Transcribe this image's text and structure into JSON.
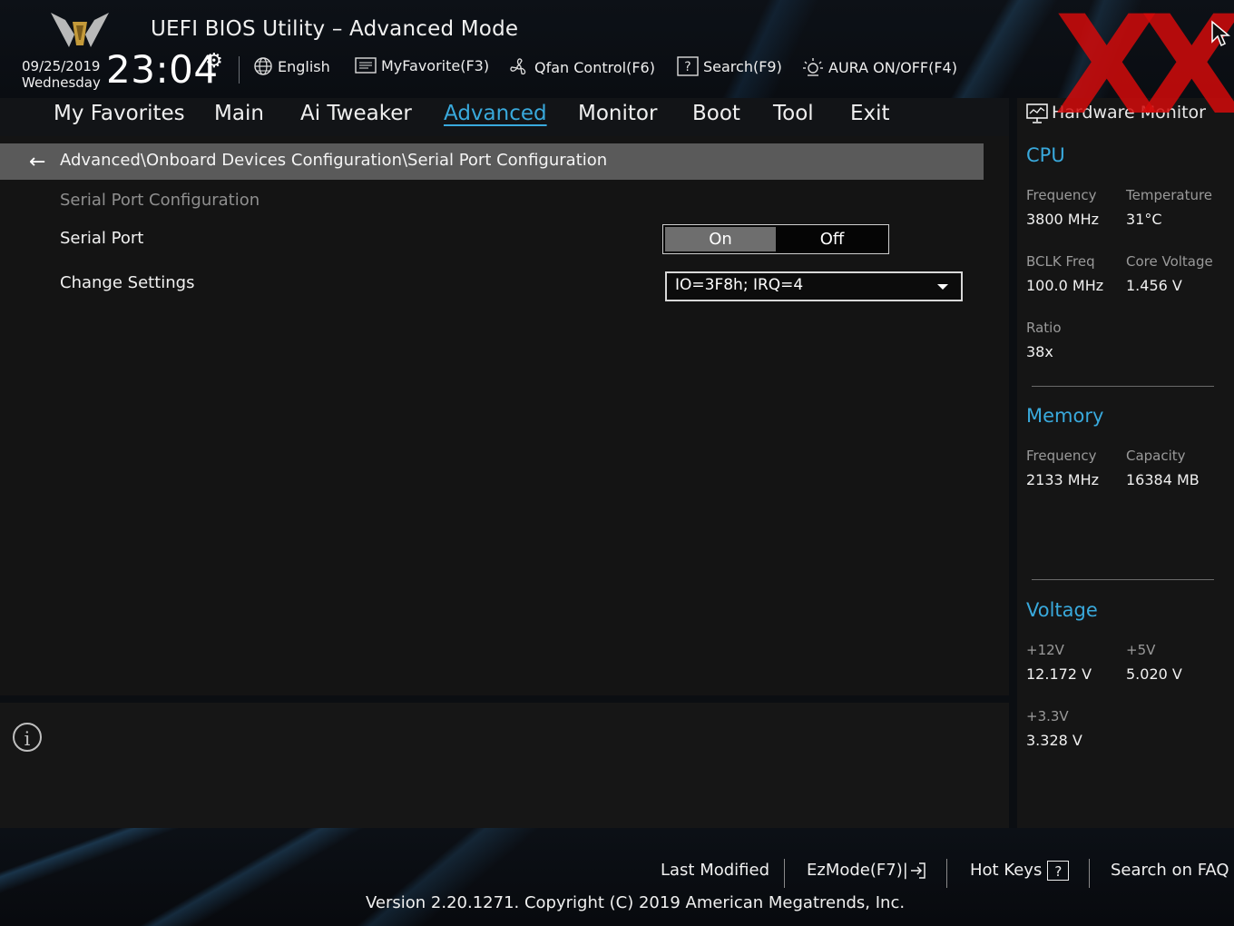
{
  "header": {
    "title": "UEFI BIOS Utility – Advanced Mode",
    "date": "09/25/2019",
    "weekday": "Wednesday",
    "time": "23:04",
    "tools": [
      {
        "label": "English",
        "icon": "globe-icon"
      },
      {
        "label": "MyFavorite(F3)",
        "icon": "favorite-list-icon"
      },
      {
        "label": "Qfan Control(F6)",
        "icon": "fan-icon"
      },
      {
        "label": "Search(F9)",
        "icon": "search-help-icon"
      },
      {
        "label": "AURA ON/OFF(F4)",
        "icon": "aura-light-icon"
      }
    ]
  },
  "nav": {
    "tabs": [
      "My Favorites",
      "Main",
      "Ai Tweaker",
      "Advanced",
      "Monitor",
      "Boot",
      "Tool",
      "Exit"
    ],
    "active": "Advanced"
  },
  "main": {
    "breadcrumb": "Advanced\\Onboard Devices Configuration\\Serial Port Configuration",
    "section_title": "Serial Port Configuration",
    "serial_port": {
      "label": "Serial Port",
      "on": "On",
      "off": "Off",
      "selected": "On"
    },
    "change_settings": {
      "label": "Change Settings",
      "value": "IO=3F8h; IRQ=4"
    }
  },
  "hardware_monitor": {
    "title": "Hardware Monitor",
    "cpu": {
      "heading": "CPU",
      "frequency_label": "Frequency",
      "frequency": "3800 MHz",
      "temperature_label": "Temperature",
      "temperature": "31°C",
      "bclk_label": "BCLK Freq",
      "bclk": "100.0 MHz",
      "core_voltage_label": "Core Voltage",
      "core_voltage": "1.456 V",
      "ratio_label": "Ratio",
      "ratio": "38x"
    },
    "memory": {
      "heading": "Memory",
      "frequency_label": "Frequency",
      "frequency": "2133 MHz",
      "capacity_label": "Capacity",
      "capacity": "16384 MB"
    },
    "voltage": {
      "heading": "Voltage",
      "v12_label": "+12V",
      "v12": "12.172 V",
      "v5_label": "+5V",
      "v5": "5.020 V",
      "v33_label": "+3.3V",
      "v33": "3.328 V"
    }
  },
  "footer": {
    "last_modified": "Last Modified",
    "ezmode": "EzMode(F7)|",
    "hot_keys": "Hot Keys",
    "hot_keys_glyph": "?",
    "faq": "Search on FAQ",
    "version": "Version 2.20.1271. Copyright (C) 2019 American Megatrends, Inc."
  },
  "colors": {
    "accent": "#39a9dc",
    "watermark": "#d20a0a",
    "panel": "#151515",
    "breadcrumb_bar": "#5a5a5a"
  }
}
